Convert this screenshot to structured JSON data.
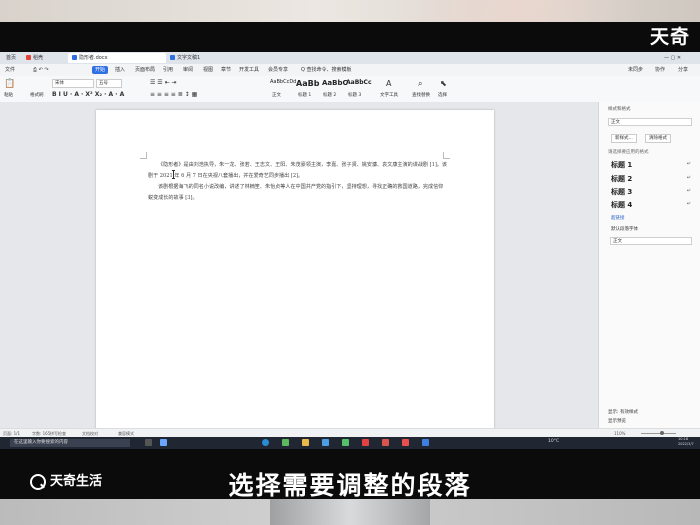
{
  "overlay": {
    "watermark_top": "天奇",
    "brand_bottom": "天奇生活",
    "caption": "选择需要调整的段落"
  },
  "window": {
    "tabs": [
      {
        "label": "首页"
      },
      {
        "label": "稻壳"
      },
      {
        "label": "隐形者.docx"
      },
      {
        "label": "文字文稿1"
      }
    ]
  },
  "menu": {
    "items": [
      "文件",
      "开始",
      "插入",
      "页面布局",
      "引用",
      "审阅",
      "视图",
      "章节",
      "开发工具",
      "会员专享"
    ],
    "active": "开始",
    "search": "Q 查找命令、搜索模板",
    "right": [
      "未同步",
      "协作",
      "分享"
    ]
  },
  "ribbon": {
    "paste": "粘贴",
    "format_painter": "格式刷",
    "font": "宋体",
    "font_size": "五号",
    "styles": [
      "AaBbCcDd",
      "AaBb",
      "AaBbC",
      "AaBbCc"
    ],
    "style_names": [
      "正文",
      "标题 1",
      "标题 2",
      "标题 3"
    ],
    "text_tools": "文字工具",
    "find_replace": "查找替换",
    "select": "选择"
  },
  "document": {
    "paragraphs": [
      "《隐形者》是由刘浩执导，朱一龙、张若、王志文、王阳、朱茂豪领主演，李嘉、张子贤、姚安濂、袁文康主演的谍战剧 [1]。该剧于 2021 年 6 月 7 日在央视八套播出，并在爱奇艺同步播出 [2]。",
      "该剧根据海飞的同名小说改编，讲述了林楠笙、朱怡贞等人在中国共产党的指引下，坚持理想，寻找正确的救国道路，完成信仰蜕变成长的故事 [3]。"
    ]
  },
  "side_panel": {
    "title": "样式和格式",
    "current": "正文",
    "new_style": "新样式...",
    "clear_format": "清除格式",
    "subtitle": "请选择要应用的格式",
    "styles": [
      "标题 1",
      "标题 2",
      "标题 3",
      "标题 4"
    ],
    "hyperlink": "超链接",
    "default_font": "默认段落字体",
    "normal": "正文",
    "show_label": "显示: 有效样式",
    "preview": "显示预览"
  },
  "status": {
    "page": "页面: 1/1",
    "words": "字数: 165",
    "spell": "拼写检查",
    "doc_check": "文档校对",
    "compat": "兼容模式",
    "zoom": "110%"
  },
  "taskbar": {
    "search_placeholder": "在这里输入你要搜索的内容",
    "weather": "10°C",
    "time": "10:18",
    "date": "2022/3/7"
  }
}
